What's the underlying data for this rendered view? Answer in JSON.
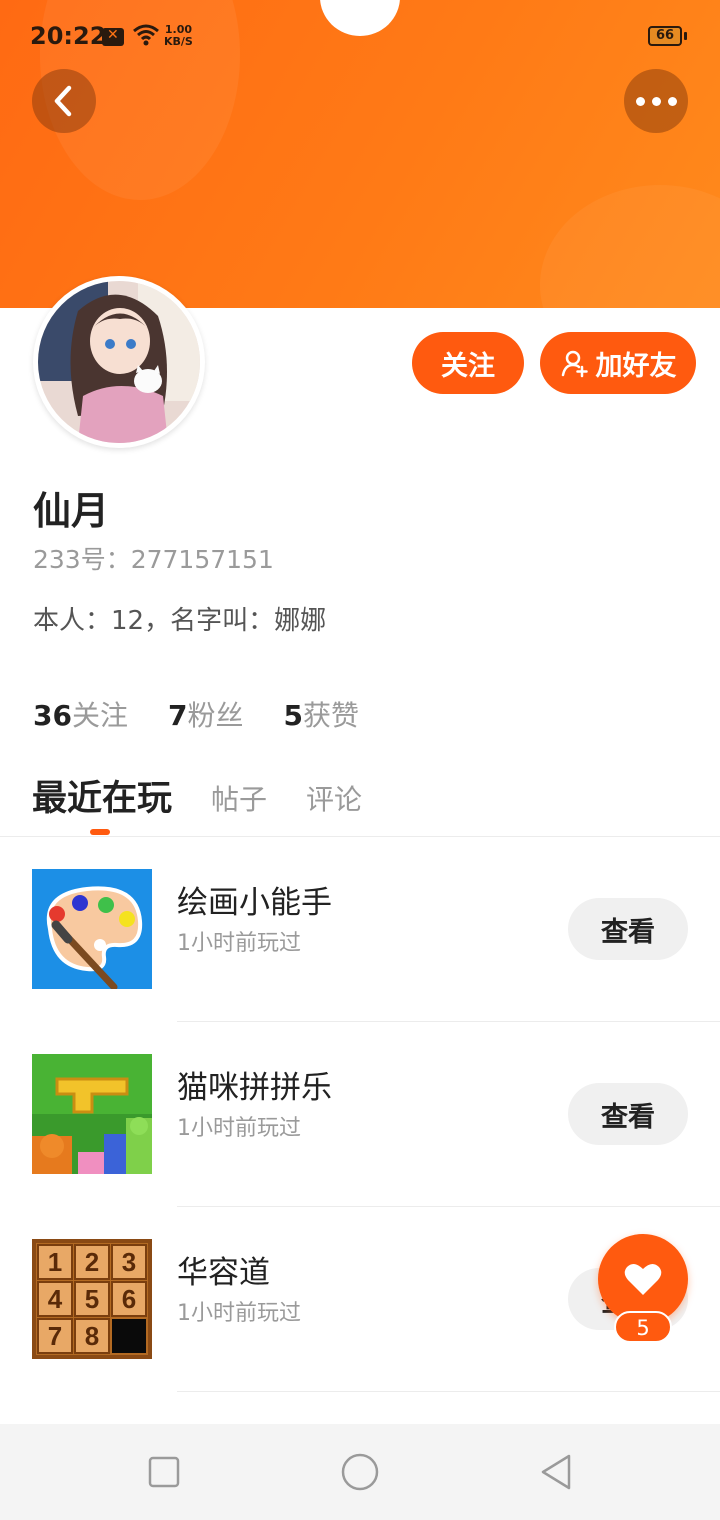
{
  "status_bar": {
    "time": "20:22",
    "net_speed_value": "1.00",
    "net_speed_unit": "KB/S",
    "battery": "66",
    "notification_icon": "x-notification-icon",
    "wifi_icon": "wifi-icon"
  },
  "header": {
    "back_icon": "chevron-left-icon",
    "more_icon": "more-dots-icon",
    "accent_color": "#ff5a0f"
  },
  "profile": {
    "name": "仙月",
    "uid_label": "233号：277157151",
    "bio": "本人：12，名字叫：娜娜",
    "follow_label": "关注",
    "add_friend_label": "加好友"
  },
  "stats": [
    {
      "value": "36",
      "label": "关注"
    },
    {
      "value": "7",
      "label": "粉丝"
    },
    {
      "value": "5",
      "label": "获赞"
    }
  ],
  "tabs": [
    {
      "label": "最近在玩",
      "active": true
    },
    {
      "label": "帖子",
      "active": false
    },
    {
      "label": "评论",
      "active": false
    }
  ],
  "games": [
    {
      "title": "绘画小能手",
      "subtitle": "1小时前玩过",
      "button": "查看",
      "icon": "paint-palette-icon"
    },
    {
      "title": "猫咪拼拼乐",
      "subtitle": "1小时前玩过",
      "button": "查看",
      "icon": "cat-puzzle-icon"
    },
    {
      "title": "华容道",
      "subtitle": "1小时前玩过",
      "button": "查看",
      "icon": "number-slide-puzzle-icon"
    }
  ],
  "puzzle_tiles": [
    "1",
    "2",
    "3",
    "4",
    "5",
    "6",
    "7",
    "8"
  ],
  "like": {
    "count": "5",
    "icon": "heart-icon"
  },
  "nav": {
    "recent_icon": "square-icon",
    "home_icon": "circle-icon",
    "back_icon": "triangle-back-icon"
  }
}
